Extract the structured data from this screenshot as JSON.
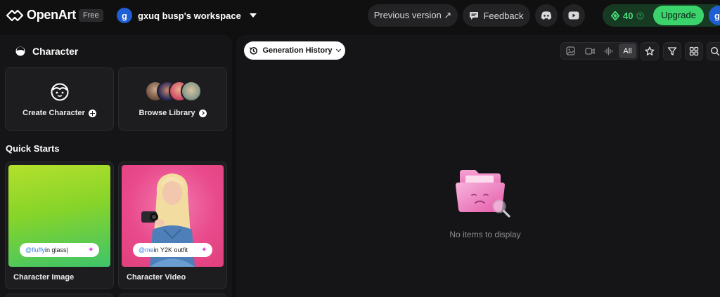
{
  "topbar": {
    "logo_text": "OpenArt",
    "plan_badge": "Free",
    "workspace_initial": "g",
    "workspace_name": "gxuq busp's workspace",
    "previous_version": "Previous version ↗",
    "feedback": "Feedback",
    "credits": "40",
    "upgrade": "Upgrade",
    "user_initial": "g"
  },
  "sidebar": {
    "title": "Character",
    "create_character": "Create Character",
    "browse_library": "Browse Library",
    "quick_starts_title": "Quick Starts",
    "quick_starts": [
      {
        "label": "Character Image",
        "mention": "@fluffy",
        "prompt_rest": " in glass"
      },
      {
        "label": "Character Video",
        "mention": "@me",
        "prompt_rest": " in Y2K outfit"
      }
    ]
  },
  "main": {
    "generation_history": "Generation History",
    "filter_all": "All",
    "empty_text": "No items to display"
  },
  "colors": {
    "accent_green": "#3bd36b",
    "credits_green": "#46e07a",
    "avatar_blue": "#1e5fd6",
    "background": "#0f0f10",
    "panel": "#151517"
  }
}
